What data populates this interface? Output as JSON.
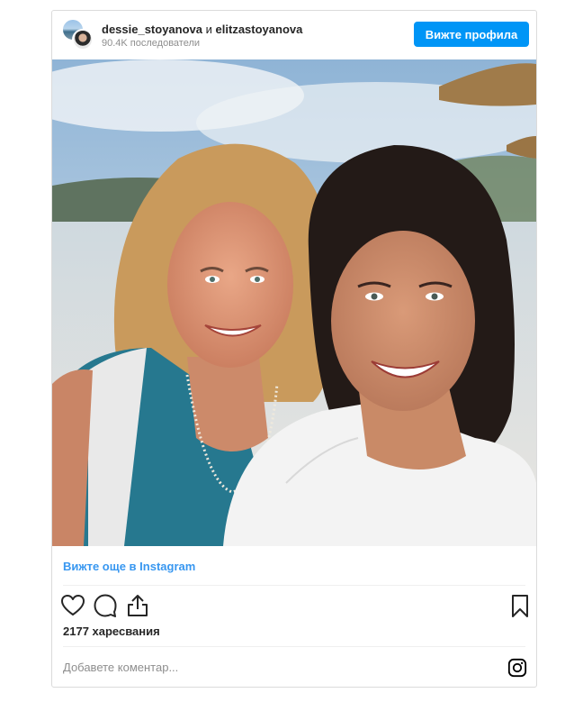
{
  "header": {
    "user1": "dessie_stoyanova",
    "conjunction": "и",
    "user2": "elitzastoyanova",
    "followers": "90.4K последователи",
    "view_profile_label": "Вижте профила"
  },
  "photo": {
    "icon": "photo-two-women-selfie-beach"
  },
  "links": {
    "view_more": "Вижте още в Instagram"
  },
  "actions": {
    "icons": [
      "heart-icon",
      "comment-icon",
      "share-icon",
      "bookmark-icon"
    ]
  },
  "likes": "2177 харесвания",
  "comment": {
    "placeholder": "Добавете коментар...",
    "logo_icon": "instagram-icon"
  },
  "colors": {
    "accent": "#0095f6",
    "link": "#3897f0",
    "border": "#dbdbdb",
    "muted": "#8e8e8e"
  }
}
